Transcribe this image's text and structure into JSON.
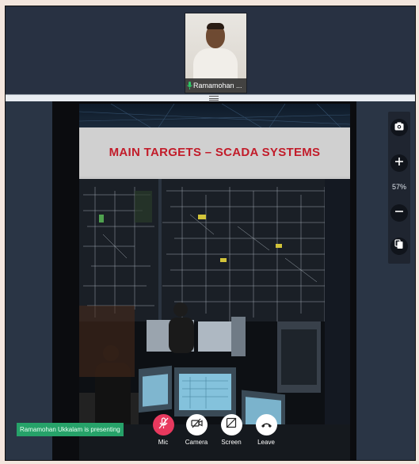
{
  "participant": {
    "name": "Ramamohan ..."
  },
  "slide": {
    "title": "MAIN TARGETS – SCADA  SYSTEMS"
  },
  "toolbar": {
    "zoom": "57%"
  },
  "status": {
    "presenting": "Ramamohan Ukkalam is presenting"
  },
  "controls": {
    "mic": "Mic",
    "camera": "Camera",
    "screen": "Screen",
    "leave": "Leave"
  },
  "colors": {
    "presenting_badge": "#26a269",
    "mic_button": "#e8395e",
    "slide_title": "#c21c2a"
  }
}
